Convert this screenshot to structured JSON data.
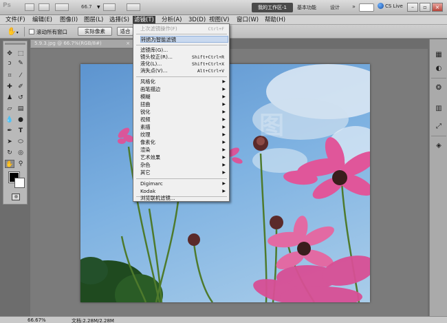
{
  "app": {
    "logo": "Ps",
    "zoom_value": "66.7",
    "workspace_button": "我的工作区-1",
    "essentials": "基本功能",
    "design": "设计",
    "more_arrow": "»",
    "cs_live": "CS Live",
    "window_controls": {
      "minimize": "–",
      "restore": "▫",
      "close": "×"
    }
  },
  "menubar": {
    "items": [
      "文件(F)",
      "编辑(E)",
      "图像(I)",
      "图层(L)",
      "选择(S)",
      "滤镜(T)",
      "分析(A)",
      "3D(D)",
      "视图(V)",
      "窗口(W)",
      "帮助(H)"
    ],
    "active": "滤镜(T)"
  },
  "options_bar": {
    "scroll_all_label": "滚动所有窗口",
    "scroll_all_checked": false,
    "actual_pixels": "实际像素",
    "fit_screen": "适合"
  },
  "document": {
    "tab_title": "5.9.3.jpg @ 66.7%(RGB/8#)",
    "close_glyph": "×"
  },
  "status_bar": {
    "zoom": "66.67%",
    "doc_size": "文档:2.28M/2.28M"
  },
  "filter_menu": {
    "items": [
      {
        "label": "上次滤镜操作(F)",
        "shortcut": "Ctrl+F",
        "disabled": true
      },
      {
        "label": "转换为智能滤镜",
        "highlighted": true
      },
      {
        "label": "滤镜库(G)..."
      },
      {
        "label": "镜头校正(R)...",
        "shortcut": "Shift+Ctrl+R"
      },
      {
        "label": "液化(L)...",
        "shortcut": "Shift+Ctrl+X"
      },
      {
        "label": "消失点(V)...",
        "shortcut": "Alt+Ctrl+V"
      },
      {
        "label": "风格化",
        "submenu": true
      },
      {
        "label": "画笔描边",
        "submenu": true
      },
      {
        "label": "模糊",
        "submenu": true
      },
      {
        "label": "扭曲",
        "submenu": true
      },
      {
        "label": "锐化",
        "submenu": true
      },
      {
        "label": "视频",
        "submenu": true
      },
      {
        "label": "素描",
        "submenu": true
      },
      {
        "label": "纹理",
        "submenu": true
      },
      {
        "label": "像素化",
        "submenu": true
      },
      {
        "label": "渲染",
        "submenu": true
      },
      {
        "label": "艺术效果",
        "submenu": true
      },
      {
        "label": "杂色",
        "submenu": true
      },
      {
        "label": "其它",
        "submenu": true
      },
      {
        "label": "Digimarc",
        "submenu": true
      },
      {
        "label": "Kodak",
        "submenu": true
      },
      {
        "label": "浏览联机滤镜..."
      }
    ]
  },
  "tools": {
    "names": [
      "move",
      "marquee",
      "lasso",
      "quick-select",
      "crop",
      "eyedropper",
      "healing",
      "brush",
      "clone-stamp",
      "history-brush",
      "eraser",
      "gradient",
      "blur",
      "dodge",
      "pen",
      "type",
      "path-select",
      "shape",
      "3d-rotate",
      "3d-orbit",
      "hand",
      "zoom"
    ],
    "selected": "hand",
    "foreground_color": "#000000",
    "background_color": "#ffffff"
  },
  "right_panel_icons": [
    "history-icon",
    "color-icon",
    "adjustments-icon",
    "styles-icon",
    "transform-icon",
    "layers-icon"
  ],
  "colors": {
    "menu_active": "#3d3d3d",
    "menu_highlight": "#c9d9ef",
    "flower_pink": "#e0569a"
  }
}
